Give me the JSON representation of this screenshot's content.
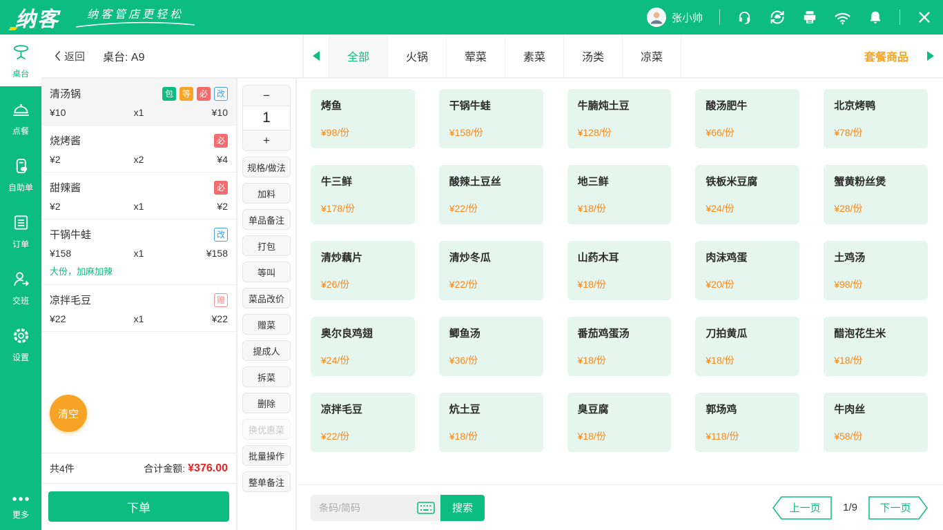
{
  "theme": {
    "primary_green": "#0DBC80",
    "accent_orange": "#F7A326",
    "price_orange": "#F7871E",
    "danger_red": "#F56C6C",
    "total_red": "#F01E1E",
    "info_blue": "#3E9BFF",
    "dish_card_bg": "#E5F6EE"
  },
  "topbar": {
    "logo_text": "纳客",
    "slogan": "纳客管店更轻松",
    "user_name": "张小帅",
    "icons": [
      "customer-service-icon",
      "cloud-sync-icon",
      "printer-icon",
      "wifi-icon",
      "notification-icon",
      "close-icon"
    ]
  },
  "sidebar": {
    "items": [
      {
        "label": "桌台",
        "icon": "table-icon",
        "active": true
      },
      {
        "label": "点餐",
        "icon": "dish-cloche-icon",
        "active": false
      },
      {
        "label": "自助单",
        "icon": "self-order-icon",
        "active": false
      },
      {
        "label": "订单",
        "icon": "order-list-icon",
        "active": false
      },
      {
        "label": "交班",
        "icon": "shift-handover-icon",
        "active": false
      },
      {
        "label": "设置",
        "icon": "settings-gear-icon",
        "active": false
      }
    ],
    "more_label": "更多"
  },
  "header": {
    "back_label": "返回",
    "table_label": "桌台: A9"
  },
  "tabs": {
    "items": [
      "全部",
      "火锅",
      "荤菜",
      "素菜",
      "汤类",
      "凉菜"
    ],
    "active_index": 0,
    "combo_label": "套餐商品"
  },
  "order": {
    "items": [
      {
        "name": "清汤锅",
        "price": "¥10",
        "qty": "x1",
        "total": "¥10",
        "selected": true,
        "badges": [
          {
            "label": "包",
            "type": "green"
          },
          {
            "label": "等",
            "type": "orange"
          },
          {
            "label": "必",
            "type": "red"
          },
          {
            "label": "改",
            "type": "blue-outline"
          }
        ]
      },
      {
        "name": "烧烤酱",
        "price": "¥2",
        "qty": "x2",
        "total": "¥4",
        "selected": false,
        "badges": [
          {
            "label": "必",
            "type": "red"
          }
        ]
      },
      {
        "name": "甜辣酱",
        "price": "¥2",
        "qty": "x1",
        "total": "¥2",
        "selected": false,
        "badges": [
          {
            "label": "必",
            "type": "red"
          }
        ]
      },
      {
        "name": "干锅牛蛙",
        "price": "¥158",
        "qty": "x1",
        "total": "¥158",
        "selected": false,
        "badges": [
          {
            "label": "改",
            "type": "blue-outline"
          }
        ],
        "note": "大份，加麻加辣"
      },
      {
        "name": "凉拌毛豆",
        "price": "¥22",
        "qty": "x1",
        "total": "¥22",
        "selected": false,
        "badges": [
          {
            "label": "赠",
            "type": "pink-outline"
          }
        ]
      }
    ],
    "clear_label": "清空",
    "count_label": "共4件",
    "total_label": "合计金额:",
    "total_amount": "¥376.00",
    "submit_label": "下单"
  },
  "toolbar": {
    "minus": "−",
    "qty": "1",
    "plus": "+",
    "buttons": [
      {
        "label": "规格/做法",
        "disabled": false
      },
      {
        "label": "加料",
        "disabled": false
      },
      {
        "label": "单品备注",
        "disabled": false
      },
      {
        "label": "打包",
        "disabled": false
      },
      {
        "label": "等叫",
        "disabled": false
      },
      {
        "label": "菜品改价",
        "disabled": false
      },
      {
        "label": "赠菜",
        "disabled": false
      },
      {
        "label": "提成人",
        "disabled": false
      },
      {
        "label": "拆菜",
        "disabled": false
      },
      {
        "label": "删除",
        "disabled": false
      },
      {
        "label": "换优惠菜",
        "disabled": true
      },
      {
        "label": "批量操作",
        "disabled": false
      },
      {
        "label": "整单备注",
        "disabled": false
      }
    ]
  },
  "menu": {
    "items": [
      {
        "name": "烤鱼",
        "price": "¥98/份"
      },
      {
        "name": "干锅牛蛙",
        "price": "¥158/份"
      },
      {
        "name": "牛腩炖土豆",
        "price": "¥128/份"
      },
      {
        "name": "酸汤肥牛",
        "price": "¥66/份"
      },
      {
        "name": "北京烤鸭",
        "price": "¥78/份"
      },
      {
        "name": "牛三鲜",
        "price": "¥178/份"
      },
      {
        "name": "酸辣土豆丝",
        "price": "¥22/份"
      },
      {
        "name": "地三鲜",
        "price": "¥18/份"
      },
      {
        "name": "铁板米豆腐",
        "price": "¥24/份"
      },
      {
        "name": "蟹黄粉丝煲",
        "price": "¥28/份"
      },
      {
        "name": "清炒藕片",
        "price": "¥26/份"
      },
      {
        "name": "清炒冬瓜",
        "price": "¥22/份"
      },
      {
        "name": "山药木耳",
        "price": "¥18/份"
      },
      {
        "name": "肉沫鸡蛋",
        "price": "¥20/份"
      },
      {
        "name": "土鸡汤",
        "price": "¥98/份"
      },
      {
        "name": "奥尔良鸡翅",
        "price": "¥24/份"
      },
      {
        "name": "鲫鱼汤",
        "price": "¥36/份"
      },
      {
        "name": "番茄鸡蛋汤",
        "price": "¥18/份"
      },
      {
        "name": "刀拍黄瓜",
        "price": "¥18/份"
      },
      {
        "name": "醋泡花生米",
        "price": "¥18/份"
      },
      {
        "name": "凉拌毛豆",
        "price": "¥22/份"
      },
      {
        "name": "炕土豆",
        "price": "¥18/份"
      },
      {
        "name": "臭豆腐",
        "price": "¥18/份"
      },
      {
        "name": "郭场鸡",
        "price": "¥118/份"
      },
      {
        "name": "牛肉丝",
        "price": "¥58/份"
      }
    ]
  },
  "bottombar": {
    "search_placeholder": "条码/简码",
    "search_label": "搜索",
    "prev_label": "上一页",
    "page_indicator": "1/9",
    "next_label": "下一页"
  }
}
